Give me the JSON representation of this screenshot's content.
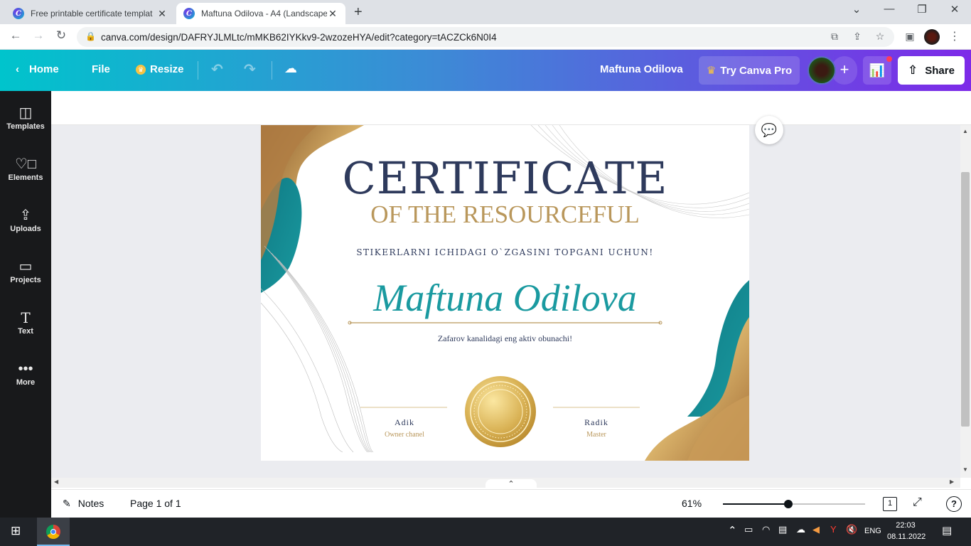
{
  "browser": {
    "tabs": [
      {
        "title": "Free printable certificate templat",
        "active": false
      },
      {
        "title": "Maftuna Odilova - A4 (Landscape",
        "active": true
      }
    ],
    "url": "canva.com/design/DAFRYJLMLtc/mMKB62IYKkv9-2wzozeHYA/edit?category=tACZCk6N0I4"
  },
  "canva": {
    "home_label": "Home",
    "file_label": "File",
    "resize_label": "Resize",
    "design_name": "Maftuna Odilova",
    "try_pro_label": "Try Canva Pro",
    "share_label": "Share",
    "sidebar": [
      {
        "label": "Templates",
        "icon": "templates-icon"
      },
      {
        "label": "Elements",
        "icon": "elements-icon"
      },
      {
        "label": "Uploads",
        "icon": "uploads-icon"
      },
      {
        "label": "Projects",
        "icon": "folder-icon"
      },
      {
        "label": "Text",
        "icon": "text-icon"
      },
      {
        "label": "More",
        "icon": "more-icon"
      }
    ]
  },
  "certificate": {
    "title": "CERTIFICATE",
    "subtitle": "OF THE RESOURCEFUL",
    "reason": "STIKERLARNI ICHIDAGI O`ZGASINI TOPGANI UCHUN!",
    "recipient": "Maftuna Odilova",
    "description": "Zafarov kanalidagi eng aktiv obunachi!",
    "signer_left_name": "Adik",
    "signer_left_role": "Owner chanel",
    "signer_right_name": "Radik",
    "signer_right_role": "Master",
    "colors": {
      "navy": "#2e3a5c",
      "gold": "#b9975b",
      "teal": "#1a9aa0"
    }
  },
  "bottom": {
    "notes_label": "Notes",
    "page_label": "Page 1 of 1",
    "zoom_label": "61%",
    "zoom_fraction": 0.46,
    "page_count": "1"
  },
  "taskbar": {
    "lang": "ENG",
    "time": "22:03",
    "date": "08.11.2022"
  }
}
